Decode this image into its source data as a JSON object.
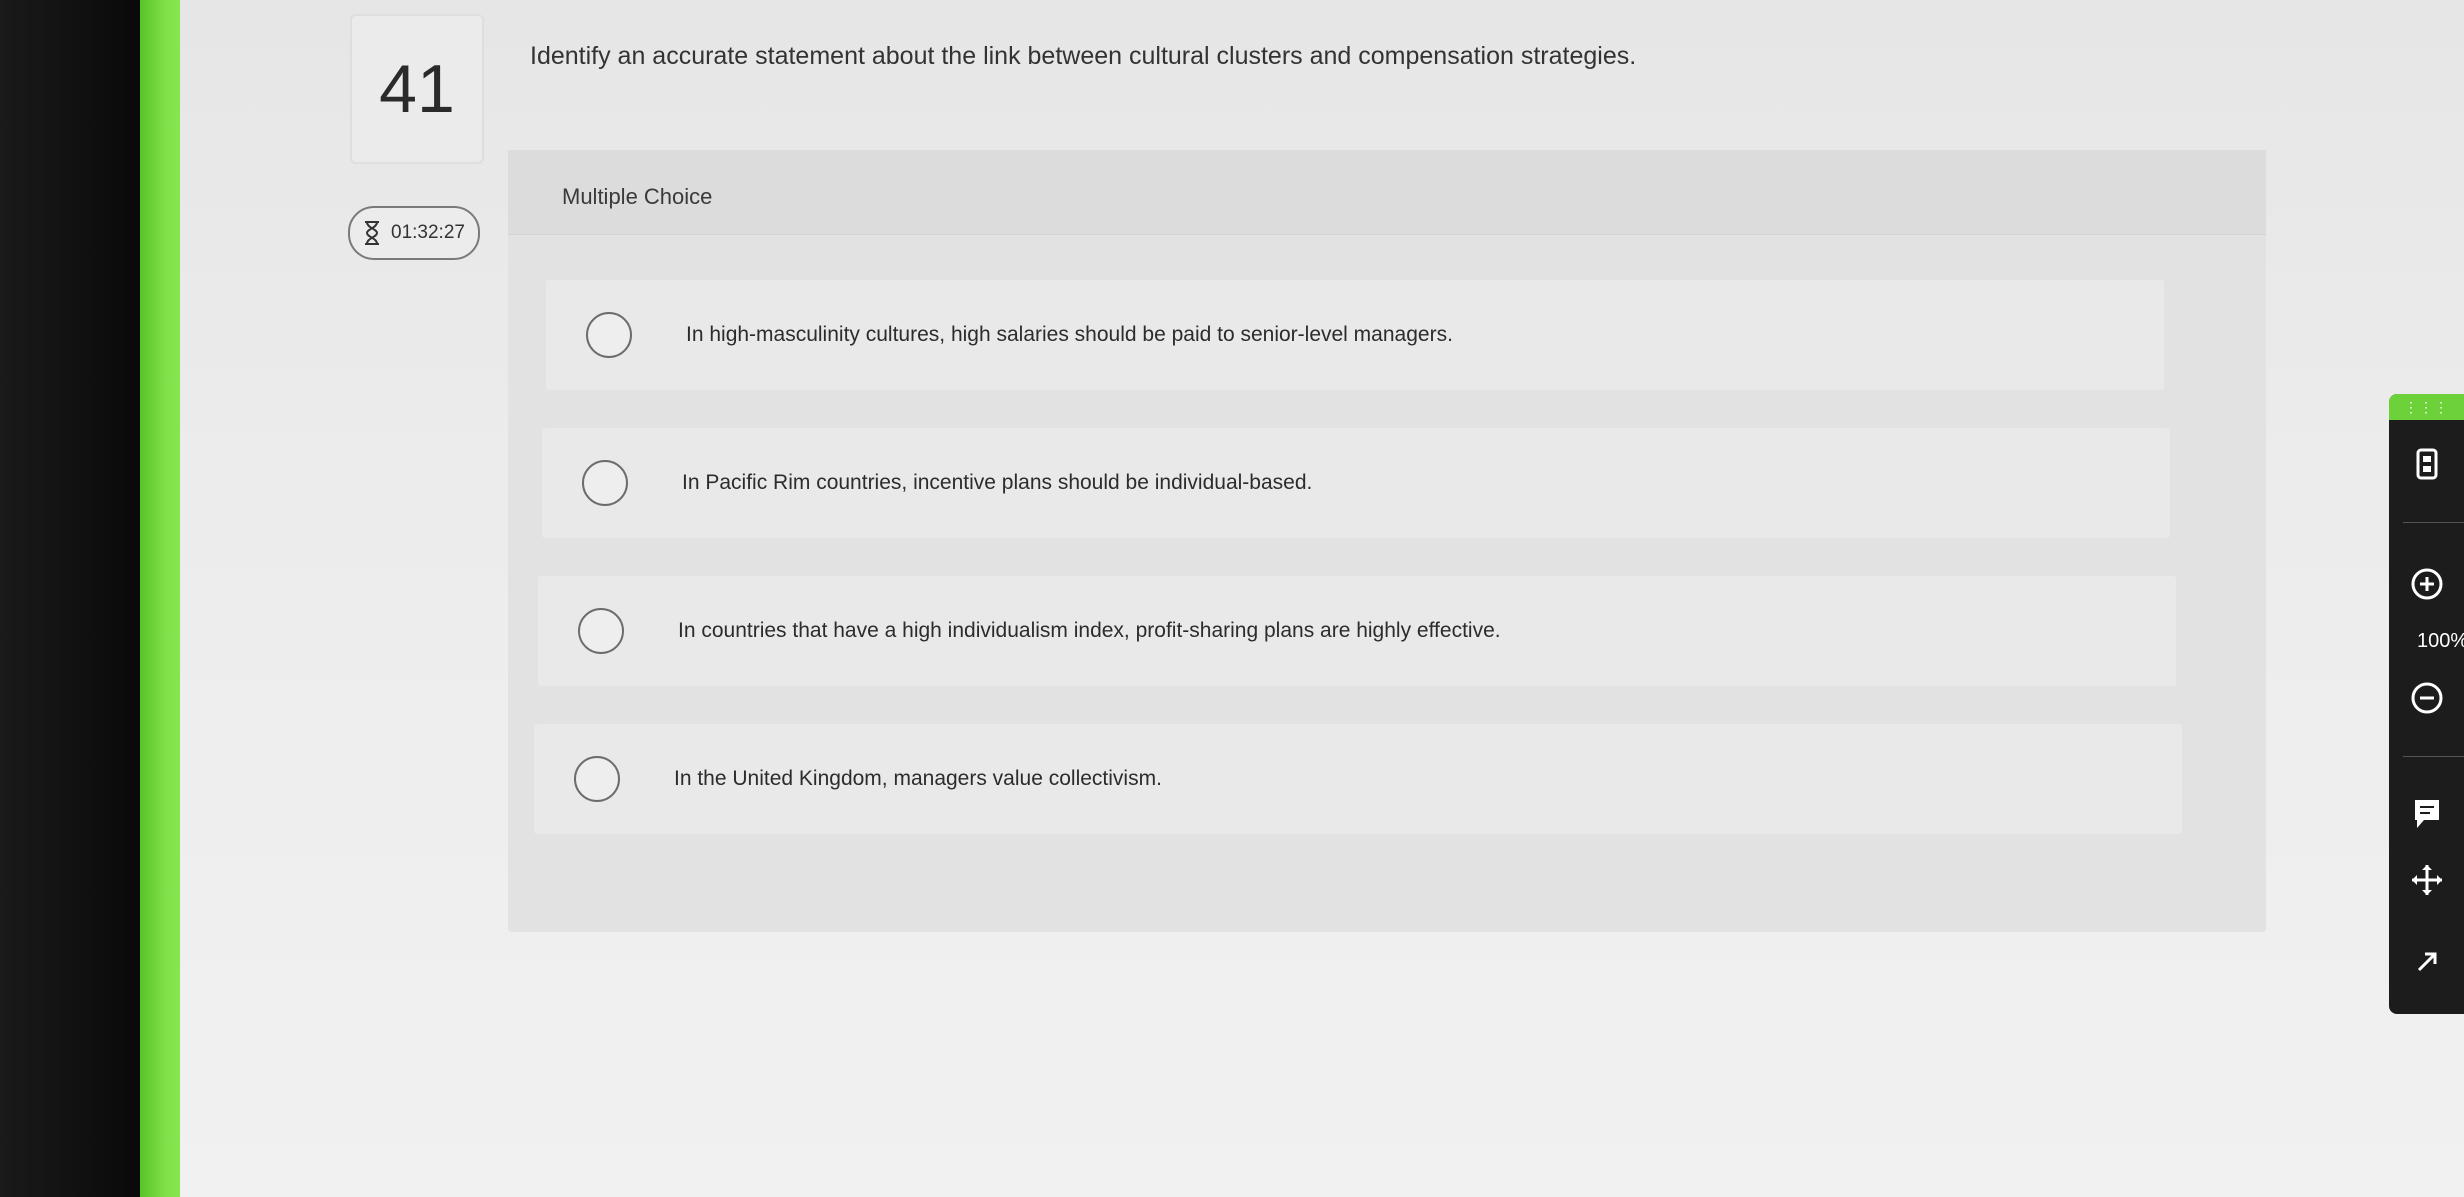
{
  "question": {
    "number": "41",
    "text": "Identify an accurate statement about the link between cultural clusters and compensation strategies."
  },
  "timer": {
    "value": "01:32:27",
    "icon": "hourglass-icon"
  },
  "multiple_choice": {
    "label": "Multiple Choice",
    "options": [
      {
        "text": "In high-masculinity cultures, high salaries should be paid to senior-level managers.",
        "selected": false
      },
      {
        "text": "In Pacific Rim countries, incentive plans should be individual-based.",
        "selected": false
      },
      {
        "text": "In countries that have a high individualism index, profit-sharing plans are highly effective.",
        "selected": false
      },
      {
        "text": "In the United Kingdom, managers value collectivism.",
        "selected": false
      }
    ]
  },
  "toolbar": {
    "grip": "⋮⋮⋮",
    "zoom_level": "100%",
    "icons": [
      "calculator-icon",
      "zoom-in-icon",
      "zoom-out-icon",
      "notes-icon",
      "move-icon",
      "expand-icon"
    ]
  },
  "colors": {
    "accent_green": "#6dd13a",
    "toolbar_bg": "#1c1c1c"
  }
}
